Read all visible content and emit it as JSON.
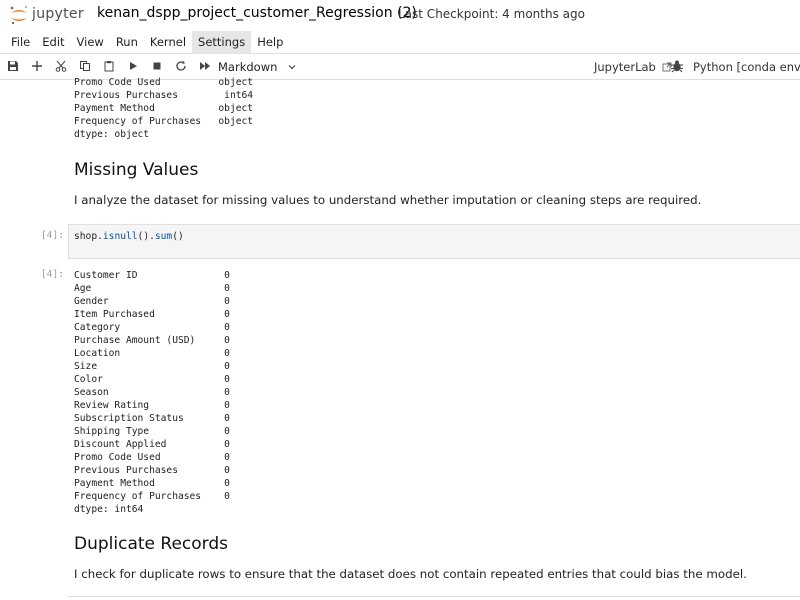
{
  "app": {
    "logo_text": "jupyter",
    "notebook_title": "kenan_dspp_project_customer_Regression (2)",
    "checkpoint": "Last Checkpoint: 4 months ago"
  },
  "menu": [
    "File",
    "Edit",
    "View",
    "Run",
    "Kernel",
    "Settings",
    "Help"
  ],
  "menu_active": "Settings",
  "toolbar": {
    "icons": [
      "save-icon",
      "add-cell-icon",
      "cut-icon",
      "copy-icon",
      "paste-icon",
      "run-icon",
      "stop-icon",
      "restart-icon",
      "run-all-icon"
    ],
    "cell_type": "Markdown",
    "jupyterlab_label": "JupyterLab",
    "kernel_label": "Python [conda env:bas"
  },
  "cells": {
    "dtypes_tail": "Promo Code Used          object\nPrevious Purchases        int64\nPayment Method           object\nFrequency of Purchases   object\ndtype: object",
    "missing_heading": "Missing Values",
    "missing_paragraph": "I analyze the dataset for missing values to understand whether imputation or cleaning steps are required.",
    "input_prompt": "[4]:",
    "code_prefix": "shop.",
    "code_fn1": "isnull",
    "code_mid": "().",
    "code_fn2": "sum",
    "code_suffix": "()",
    "output_prompt": "[4]:",
    "isnull_output": "Customer ID               0\nAge                       0\nGender                    0\nItem Purchased            0\nCategory                  0\nPurchase Amount (USD)     0\nLocation                  0\nSize                      0\nColor                     0\nSeason                    0\nReview Rating             0\nSubscription Status       0\nShipping Type             0\nDiscount Applied          0\nPromo Code Used           0\nPrevious Purchases        0\nPayment Method            0\nFrequency of Purchases    0\ndtype: int64",
    "duplicate_heading": "Duplicate Records",
    "duplicate_paragraph": "I check for duplicate rows to ensure that the dataset does not contain repeated entries that could bias the model."
  },
  "colors": {
    "logo_orange": "#f37726",
    "code_bg": "#f5f5f5",
    "prompt_gray": "#9e9e9e"
  }
}
